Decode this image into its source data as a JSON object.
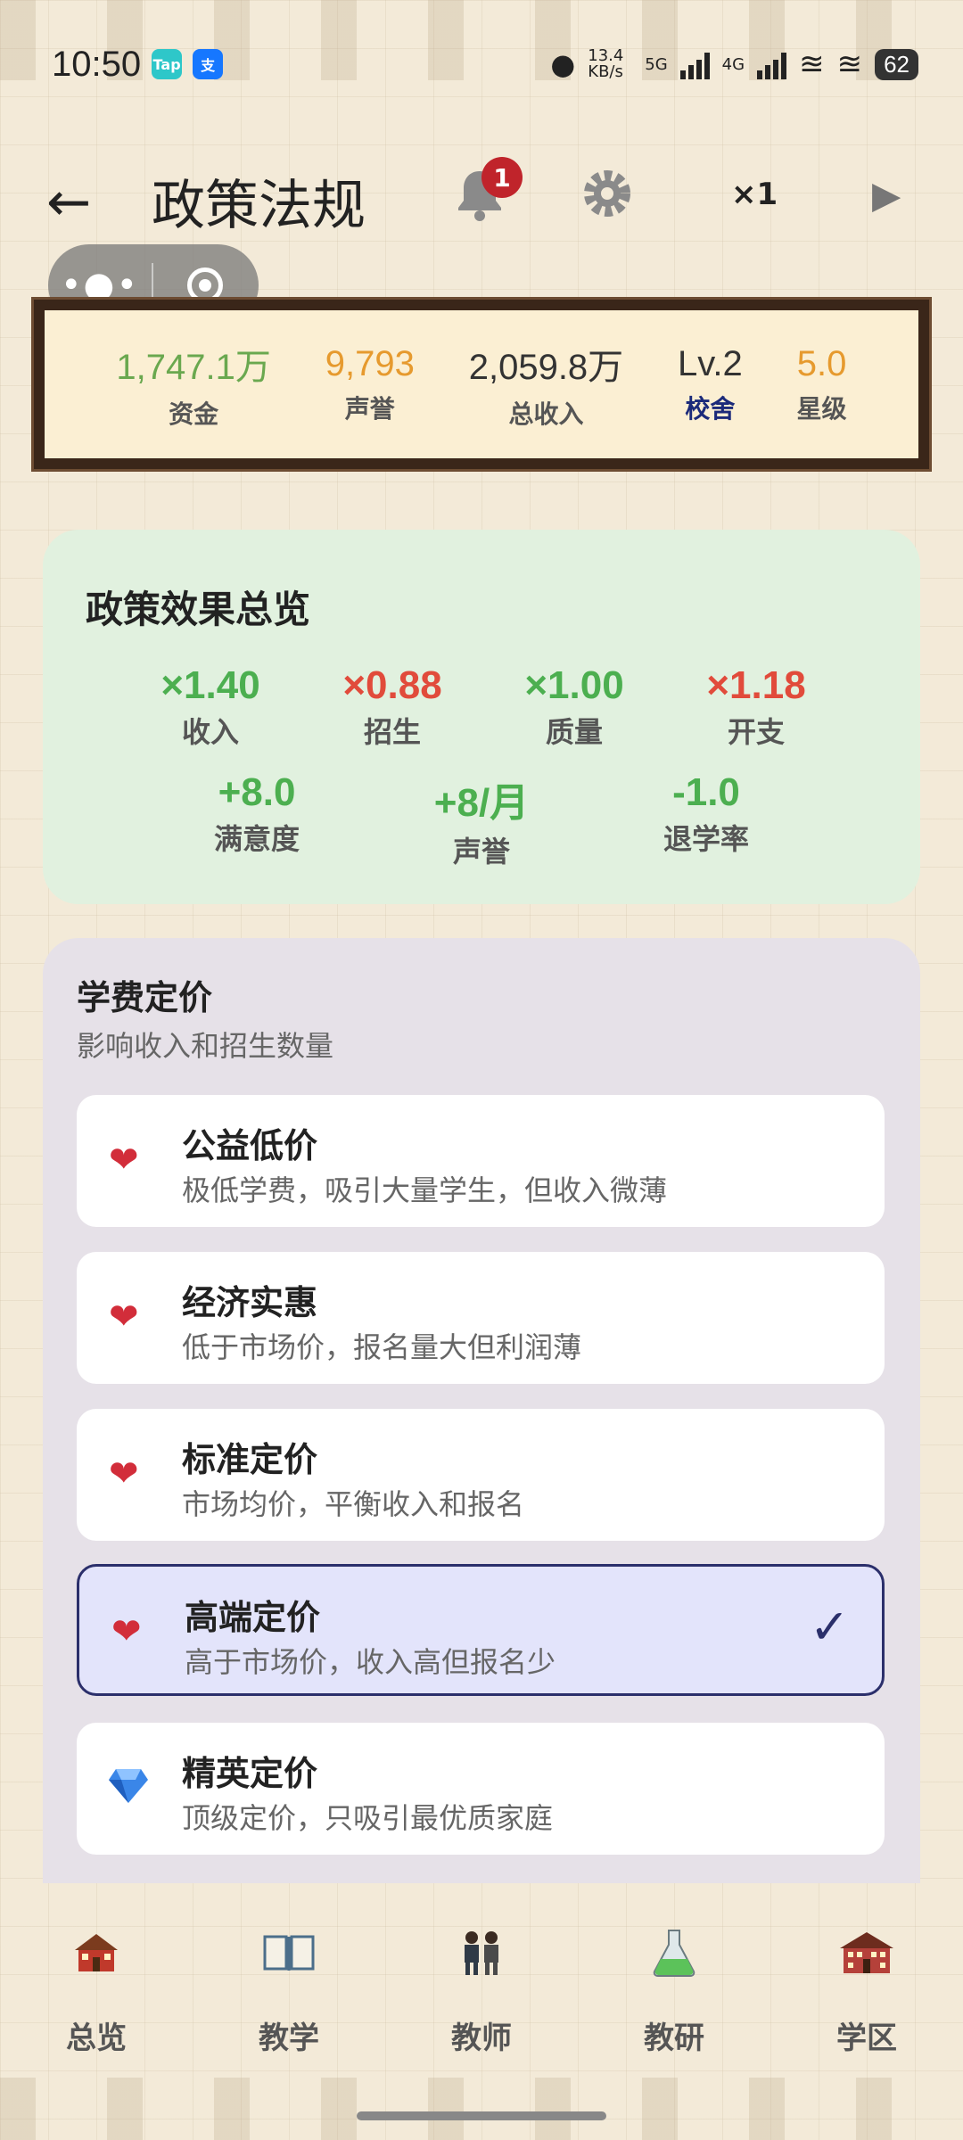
{
  "status_bar": {
    "time": "10:50",
    "badge1": "Tap",
    "badge2": "支",
    "net_speed": "13.4 KB/s",
    "sig1_label": "5G",
    "sig2_label": "4G",
    "battery": "62"
  },
  "header": {
    "back_icon": "←",
    "title": "政策法规",
    "bell_icon": "bell-icon",
    "notification_count": "1",
    "settings_icon": "gear-icon",
    "speed": "×1",
    "play_icon": "▶"
  },
  "resources": [
    {
      "value": "1,747.1万",
      "label": "资金",
      "color": "#6aa84f"
    },
    {
      "value": "9,793",
      "label": "声誉",
      "color": "#e69a2e"
    },
    {
      "value": "2,059.8万",
      "label": "总收入",
      "color": "#333333"
    },
    {
      "value": "Lv.2",
      "label": "校舍",
      "color": "#333333",
      "label_color": "#1b2a7a"
    },
    {
      "value": "5.0",
      "label": "星级",
      "color": "#e69a2e"
    }
  ],
  "overview": {
    "title": "政策效果总览",
    "row1": [
      {
        "value": "×1.40",
        "label": "收入",
        "tone": "green"
      },
      {
        "value": "×0.88",
        "label": "招生",
        "tone": "red"
      },
      {
        "value": "×1.00",
        "label": "质量",
        "tone": "green"
      },
      {
        "value": "×1.18",
        "label": "开支",
        "tone": "red"
      }
    ],
    "row2": [
      {
        "value": "+8.0",
        "label": "满意度",
        "tone": "green"
      },
      {
        "value": "+8/月",
        "label": "声誉",
        "tone": "green"
      },
      {
        "value": "-1.0",
        "label": "退学率",
        "tone": "green"
      }
    ]
  },
  "tuition": {
    "title": "学费定价",
    "subtitle": "影响收入和招生数量",
    "options": [
      {
        "icon": "heart-icon",
        "title": "公益低价",
        "desc": "极低学费，吸引大量学生，但收入微薄",
        "selected": false
      },
      {
        "icon": "heart-icon",
        "title": "经济实惠",
        "desc": "低于市场价，报名量大但利润薄",
        "selected": false
      },
      {
        "icon": "heart-icon",
        "title": "标准定价",
        "desc": "市场均价，平衡收入和报名",
        "selected": false
      },
      {
        "icon": "heart-icon",
        "title": "高端定价",
        "desc": "高于市场价，收入高但报名少",
        "selected": true
      },
      {
        "icon": "gem-icon",
        "title": "精英定价",
        "desc": "顶级定价，只吸引最优质家庭",
        "selected": false
      }
    ]
  },
  "bottom_nav": [
    {
      "label": "总览",
      "icon": "school-house-icon"
    },
    {
      "label": "教学",
      "icon": "book-icon"
    },
    {
      "label": "教师",
      "icon": "teachers-icon"
    },
    {
      "label": "教研",
      "icon": "flask-icon"
    },
    {
      "label": "学区",
      "icon": "campus-building-icon"
    }
  ]
}
